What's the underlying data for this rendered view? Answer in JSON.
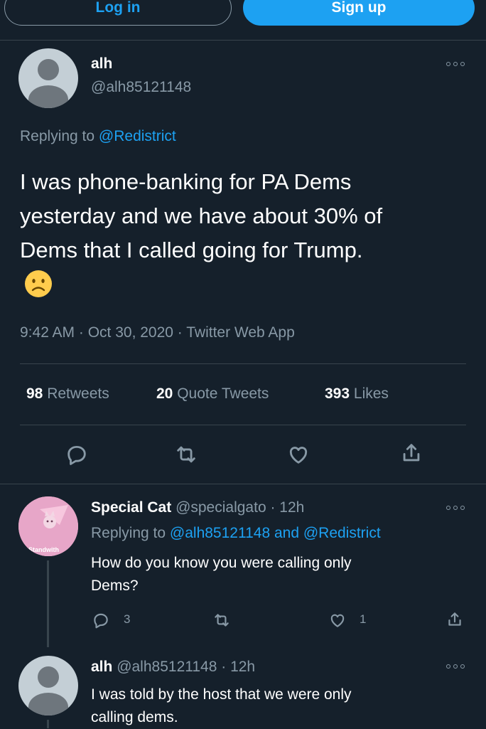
{
  "auth": {
    "login_label": "Log in",
    "signup_label": "Sign up"
  },
  "main_tweet": {
    "display_name": "alh",
    "handle": "@alh85121148",
    "replying_prefix": "Replying to",
    "replying_to": "@Redistrict",
    "text_lines": [
      "I was phone-banking for PA Dems",
      "yesterday and we have about 30% of",
      "Dems that I called going for Trump."
    ],
    "emoji": "slightly-frowning-face",
    "timestamp": "9:42 AM · Oct 30, 2020 · Twitter Web App",
    "stats": {
      "retweets_count": "98",
      "retweets_label": "Retweets",
      "quotes_count": "20",
      "quotes_label": "Quote Tweets",
      "likes_count": "393",
      "likes_label": "Likes"
    }
  },
  "replies": [
    {
      "display_name": "Special Cat",
      "handle_time": "@specialgato · 12h",
      "replying_prefix": "Replying to",
      "replying_to": "@alh85121148 and @Redistrict",
      "text_lines": [
        "How do you know you were calling only",
        "Dems?"
      ],
      "avatar_text": "Standwith",
      "reply_count": "3",
      "like_count": "1"
    },
    {
      "display_name": "alh",
      "handle_time": "@alh85121148 · 12h",
      "text_lines": [
        "I was told by the host that we were only",
        "calling dems."
      ]
    }
  ],
  "colors": {
    "background": "#15202b",
    "accent": "#1da1f2",
    "secondary_text": "#8899a6",
    "divider": "#38444d"
  }
}
